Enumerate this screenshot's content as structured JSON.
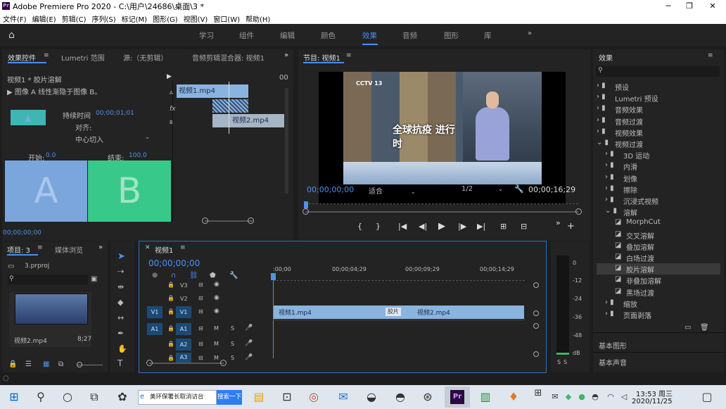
{
  "app": {
    "title": "Adobe Premiere Pro 2020 - C:\\用户\\24686\\桌面\\3 *",
    "logo": "Pr"
  },
  "menu": [
    "文件(F)",
    "编辑(E)",
    "剪辑(C)",
    "序列(S)",
    "标记(M)",
    "图形(G)",
    "视图(V)",
    "窗口(W)",
    "帮助(H)"
  ],
  "workspaces": [
    "学习",
    "组件",
    "编辑",
    "颜色",
    "效果",
    "音频",
    "图形",
    "库"
  ],
  "active_workspace": "效果",
  "effect_controls": {
    "tabs": [
      "效果控件",
      "Lumetri 范围",
      "源:（无剪辑）",
      "音频剪辑混合器: 视频1"
    ],
    "clip": "视频1 * 胶片溶解",
    "desc": "▶ 图像 A 线性渐隐于图像 B。",
    "duration_label": "持续时间",
    "duration": "00;00;01;01",
    "align_label": "对齐:",
    "align_value": "中心切入",
    "start_label": "开始:",
    "start": "0.0",
    "end_label": "结束:",
    "end": "100.0",
    "a": "A",
    "b": "B",
    "timecode": "00;00;00;00",
    "mini_time": "00",
    "mini_track_a": "A",
    "mini_track_b": "B",
    "mini_fx": "fx",
    "clip1": "视频1.mp4",
    "clip2": "视频2.mp4"
  },
  "program": {
    "title": "节目: 视频1",
    "timecode": "00;00;00;00",
    "fit": "适合",
    "res": "1/2",
    "duration": "00;00;16;29",
    "overlay_text": "全球抗疫 进行时",
    "logo": "CCTV 13"
  },
  "project": {
    "tabs": [
      "项目: 3",
      "媒体浏览"
    ],
    "file": "3.prproj",
    "clip_name": "视频2.mp4",
    "clip_dur": "8;27"
  },
  "timeline": {
    "tab": "视频1",
    "timecode": "00;00;00;00",
    "ruler": [
      ":00;00",
      "00;00;04;29",
      "00;00;09;29",
      "00;00;14;29"
    ],
    "tracks_v": [
      "V3",
      "V2",
      "V1"
    ],
    "tracks_a": [
      "A1",
      "A2",
      "A3"
    ],
    "src_v": "V1",
    "src_a": "A1",
    "clip1": "视频1.mp4",
    "clip2": "视频2.mp4",
    "transition": "胶片",
    "m": "M",
    "s": "S"
  },
  "meter": {
    "scale": [
      "0",
      "-12",
      "-24",
      "-36",
      "-48",
      "dB"
    ],
    "s_labels": [
      "S",
      "S"
    ]
  },
  "effects": {
    "title": "效果",
    "items": [
      {
        "label": "预设",
        "level": 0
      },
      {
        "label": "Lumetri 预设",
        "level": 0
      },
      {
        "label": "音频效果",
        "level": 0
      },
      {
        "label": "音频过渡",
        "level": 0
      },
      {
        "label": "视频效果",
        "level": 0
      },
      {
        "label": "视频过渡",
        "level": 0
      },
      {
        "label": "3D 运动",
        "level": 1
      },
      {
        "label": "内滑",
        "level": 1
      },
      {
        "label": "划像",
        "level": 1
      },
      {
        "label": "擦除",
        "level": 1
      },
      {
        "label": "沉浸式视频",
        "level": 1
      },
      {
        "label": "溶解",
        "level": 1
      },
      {
        "label": "MorphCut",
        "level": 2
      },
      {
        "label": "交叉溶解",
        "level": 2
      },
      {
        "label": "叠加溶解",
        "level": 2
      },
      {
        "label": "白场过渡",
        "level": 2
      },
      {
        "label": "胶片溶解",
        "level": 2
      },
      {
        "label": "非叠加溶解",
        "level": 2
      },
      {
        "label": "黑场过渡",
        "level": 2
      },
      {
        "label": "缩放",
        "level": 1
      },
      {
        "label": "页面剥落",
        "level": 1
      }
    ],
    "selected": "胶片溶解",
    "footer": [
      "基本图形",
      "基本声音"
    ]
  },
  "taskbar": {
    "search": "美环保署长取消访台",
    "search_btn": "搜索一下",
    "time": "13:53 周三",
    "date": "2020/11/25"
  },
  "colors": {
    "accent": "#4e8ff0",
    "clip": "#8ab4e0",
    "a_box": "#7aa6dc",
    "b_box": "#38c98a"
  }
}
